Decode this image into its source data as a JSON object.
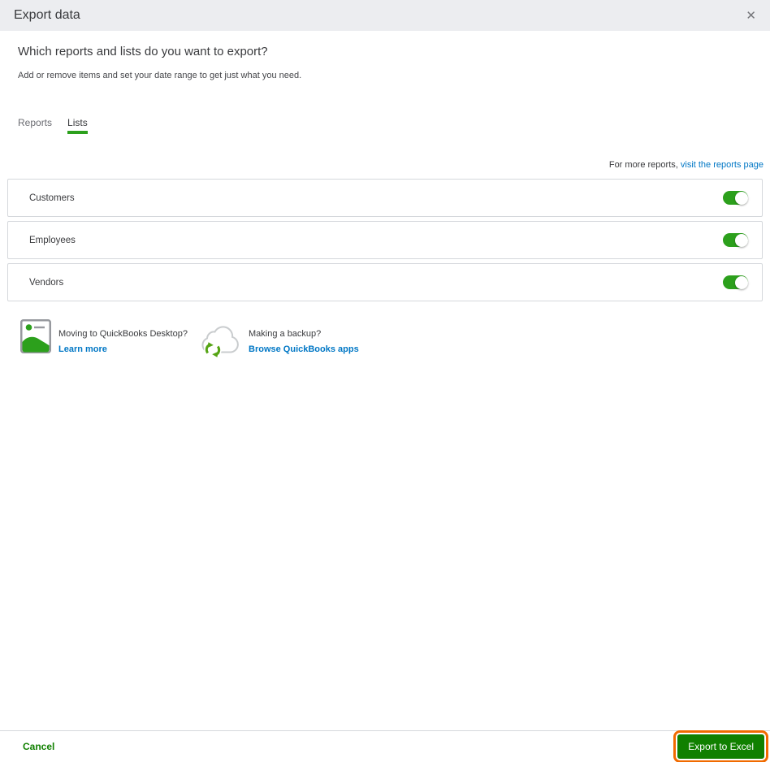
{
  "modal": {
    "title": "Export data",
    "close_icon": "✕"
  },
  "content": {
    "heading": "Which reports and lists do you want to export?",
    "subheading": "Add or remove items and set your date range to get just what you need.",
    "tabs": [
      {
        "label": "Reports",
        "active": false
      },
      {
        "label": "Lists",
        "active": true
      }
    ],
    "more_reports": {
      "prefix": "For more reports, ",
      "link_label": "visit the reports page"
    },
    "lists": [
      {
        "label": "Customers",
        "enabled": true
      },
      {
        "label": "Employees",
        "enabled": true
      },
      {
        "label": "Vendors",
        "enabled": true
      }
    ],
    "promos": [
      {
        "icon": "desktop-export-icon",
        "title": "Moving to QuickBooks Desktop?",
        "link_label": "Learn more"
      },
      {
        "icon": "cloud-sync-icon",
        "title": "Making a backup?",
        "link_label": "Browse QuickBooks apps"
      }
    ]
  },
  "footer": {
    "cancel_label": "Cancel",
    "export_label": "Export to Excel"
  },
  "colors": {
    "brand_green": "#2ca01c",
    "button_green": "#108000",
    "link_blue": "#0077c5",
    "focus_orange": "#f06a00",
    "header_bg": "#ecedf0",
    "border_gray": "#d5d8dc",
    "text_dark": "#393a3d",
    "text_gray": "#6b6c72"
  }
}
